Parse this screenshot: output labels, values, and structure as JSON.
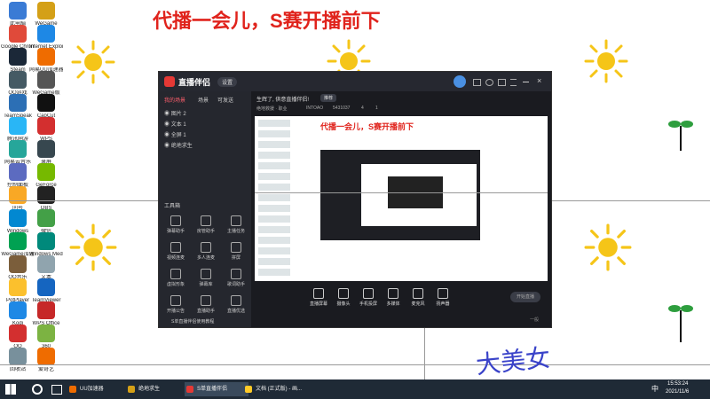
{
  "banner": {
    "text": "代播一会儿，S赛开播前下"
  },
  "desktop_icons": [
    {
      "label": "此电脑",
      "color": "#3a7bd5"
    },
    {
      "label": "WeGame",
      "color": "#d4a017"
    },
    {
      "label": "Google Chrome",
      "color": "#e04a3a"
    },
    {
      "label": "Internet Explorer",
      "color": "#1e88e5"
    },
    {
      "label": "Steam",
      "color": "#1b2838"
    },
    {
      "label": "网易UU加速器",
      "color": "#ef6c00"
    },
    {
      "label": "QQ游戏",
      "color": "#455a64"
    },
    {
      "label": "WeGame版",
      "color": "#555"
    },
    {
      "label": "TeamSpeak",
      "color": "#2c6fb5"
    },
    {
      "label": "CapCut",
      "color": "#111"
    },
    {
      "label": "腾讯网游",
      "color": "#29b6f6"
    },
    {
      "label": "WPS",
      "color": "#d32f2f"
    },
    {
      "label": "网易云音乐",
      "color": "#26a69a"
    },
    {
      "label": "录屏",
      "color": "#37474f"
    },
    {
      "label": "控制面板",
      "color": "#5c6bc0"
    },
    {
      "label": "GeForce",
      "color": "#76b900"
    },
    {
      "label": "问号",
      "color": "#f9a825"
    },
    {
      "label": "OBS",
      "color": "#222"
    },
    {
      "label": "Windows",
      "color": "#0288d1"
    },
    {
      "label": "微信",
      "color": "#43a047"
    },
    {
      "label": "WeGame加速",
      "color": "#00a152"
    },
    {
      "label": "Windows Media",
      "color": "#00897b"
    },
    {
      "label": "QQ音乐",
      "color": "#7b5e3b"
    },
    {
      "label": "文本",
      "color": "#90a4ae"
    },
    {
      "label": "PotPlayer",
      "color": "#fbc02d"
    },
    {
      "label": "TeamViewer",
      "color": "#1565c0"
    },
    {
      "label": "Kodi",
      "color": "#1e88e5"
    },
    {
      "label": "WPS Office",
      "color": "#c62828"
    },
    {
      "label": "QQ",
      "color": "#d32f2f"
    },
    {
      "label": "360",
      "color": "#7cb342"
    },
    {
      "label": "回收站",
      "color": "#78909c"
    },
    {
      "label": "爱奇艺",
      "color": "#ef6c00"
    }
  ],
  "handwriting": {
    "text": "大美女"
  },
  "window": {
    "logo": "直播伴侣",
    "version": "设置",
    "tabs": [
      "我的场景",
      "场景",
      "可发送"
    ],
    "sources": [
      "图片 2",
      "文本 1",
      "全屏 1",
      "绝地求生"
    ],
    "status": "生辉了, 供意直播伴侣!",
    "status_tag": "推荐",
    "room_info": "绝地救援 · 职业",
    "room_id": "INTOAO",
    "fans": "5431037",
    "likes": "4",
    "viewers": "1",
    "tools_header": "工具箱",
    "tools": [
      "弹幕助手",
      "房管助手",
      "主播任务",
      "视频连麦",
      "多人连麦",
      "拼屏",
      "虚拟形象",
      "弹幕库",
      "歌词助手",
      "开播公告",
      "直播助手",
      "直播优选"
    ],
    "notice": "S单直播伴侣使用教程",
    "bottom_buttons": [
      "直播屏幕",
      "摄像头",
      "手机投屏",
      "多媒体",
      "麦克风",
      "扬声器"
    ],
    "start_button": "开始直播",
    "right_text": "一般"
  },
  "taskbar": {
    "apps": [
      {
        "label": "UU加速器",
        "color": "#ef6c00"
      },
      {
        "label": "绝地求生",
        "color": "#d4a017"
      },
      {
        "label": "S单直播伴侣",
        "color": "#e53935"
      },
      {
        "label": "文档 (正式版) - 画...",
        "color": "#ffca28"
      }
    ],
    "time": "15:53:24",
    "date": "2021/11/6",
    "lang": "中"
  }
}
